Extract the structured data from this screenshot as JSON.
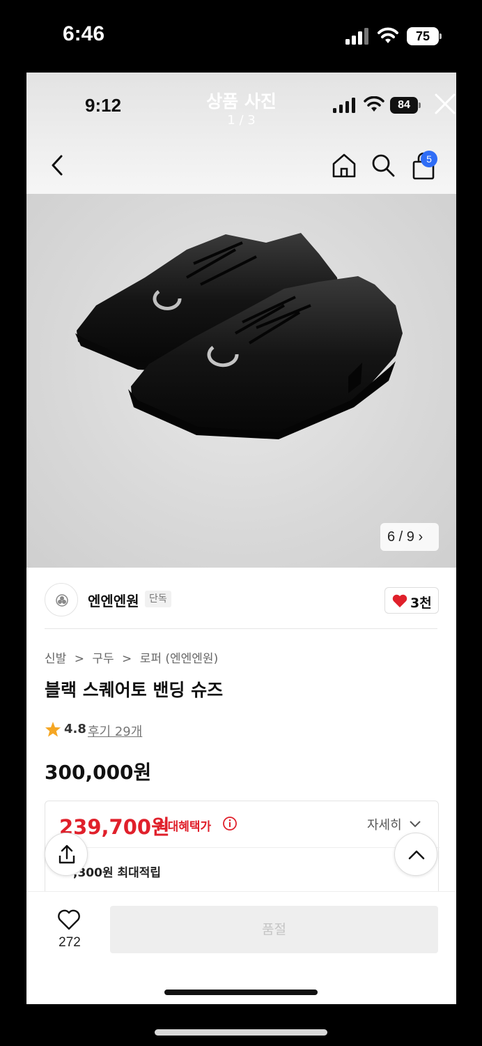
{
  "outer_status": {
    "time": "6:46",
    "battery": "75"
  },
  "inner_status": {
    "time": "9:12",
    "battery": "84"
  },
  "viewer": {
    "title": "상품 사진",
    "counter": "1 / 3"
  },
  "nav": {
    "cart_count": "5",
    "icons": [
      "back-icon",
      "home-icon",
      "search-icon",
      "shopping-bag-icon"
    ]
  },
  "image": {
    "counter": "6 / 9"
  },
  "brand": {
    "name": "엔엔엔원",
    "badge": "단독",
    "likes": "3천"
  },
  "breadcrumb": [
    "신발",
    ">",
    "구두",
    ">",
    "로퍼 (엔엔엔원)"
  ],
  "product": {
    "title": "블랙 스퀘어토 밴딩 슈즈",
    "rating": "4.8",
    "reviews": "후기 29개",
    "original_price": "300,000원"
  },
  "benefit": {
    "sale_price": "239,700원",
    "sale_label": "최대혜택가",
    "detail": "자세히",
    "points": ",300원 최대적립"
  },
  "bottom": {
    "wish_count": "272",
    "soldout": "품절"
  },
  "colors": {
    "accent_red": "#e0202b",
    "badge_blue": "#2f6df6"
  }
}
